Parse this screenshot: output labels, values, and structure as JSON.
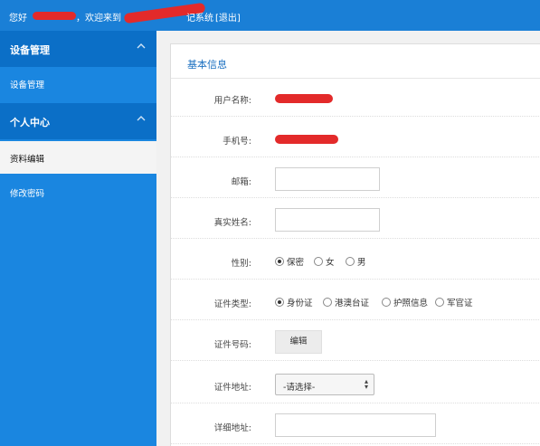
{
  "topbar": {
    "greeting": "您好",
    "welcome": "，欢迎来到",
    "system_tail": "记系统",
    "logout": "[退出]"
  },
  "sidebar": {
    "sections": [
      {
        "title": "设备管理",
        "items": [
          {
            "label": "设备管理"
          }
        ]
      },
      {
        "title": "个人中心",
        "items": [
          {
            "label": "资料编辑",
            "active": true
          },
          {
            "label": "修改密码"
          }
        ]
      }
    ]
  },
  "panel": {
    "title": "基本信息",
    "fields": {
      "username": {
        "label": "用户名称:"
      },
      "phone": {
        "label": "手机号:"
      },
      "email": {
        "label": "邮箱:",
        "value": ""
      },
      "realname": {
        "label": "真实姓名:",
        "value": ""
      },
      "gender": {
        "label": "性别:",
        "options": [
          "保密",
          "女",
          "男"
        ],
        "selected": "保密"
      },
      "id_type": {
        "label": "证件类型:",
        "options": [
          "身份证",
          "港澳台证",
          "护照信息",
          "军官证"
        ],
        "selected": "身份证"
      },
      "id_number": {
        "label": "证件号码:",
        "button": "编辑"
      },
      "id_address": {
        "label": "证件地址:",
        "selected": "-请选择-"
      },
      "detail_address": {
        "label": "详细地址:",
        "value": ""
      }
    }
  },
  "colors": {
    "topbar": "#1a7fd6",
    "sidebar": "#1a86e0",
    "sidebar_head": "#0b6fc7",
    "redaction": "#e32a2a"
  }
}
